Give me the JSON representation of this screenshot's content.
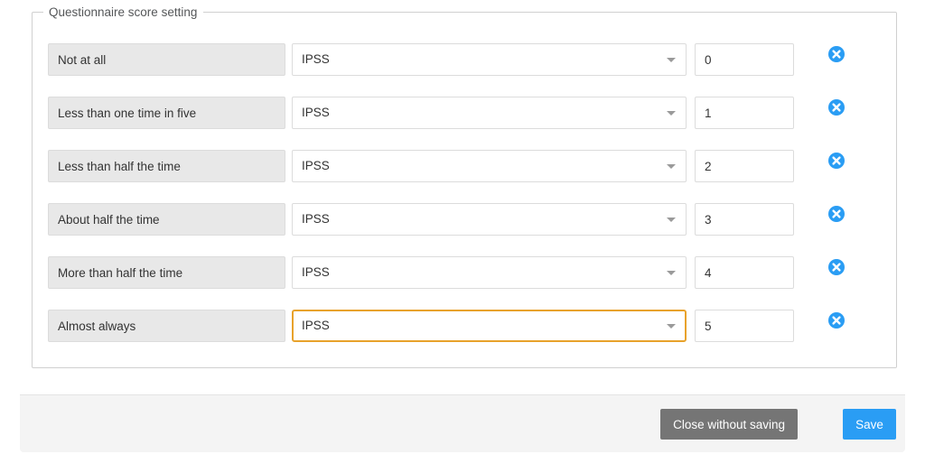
{
  "fieldset": {
    "legend": "Questionnaire score setting"
  },
  "colors": {
    "label_field_bg": "#e8e8e8",
    "focus_border": "#e8a22b",
    "delete_icon": "#2a9df4",
    "save_button": "#2a9df4",
    "close_button": "#757575",
    "footer_bg": "#f4f4f4",
    "border": "#dcdcdc"
  },
  "rows": [
    {
      "label": "Not at all",
      "questionnaire": "IPSS",
      "score": "0",
      "delete_icon": "remove-circle-icon",
      "focused": false
    },
    {
      "label": "Less than one time in five",
      "questionnaire": "IPSS",
      "score": "1",
      "delete_icon": "remove-circle-icon",
      "focused": false
    },
    {
      "label": "Less than half the time",
      "questionnaire": "IPSS",
      "score": "2",
      "delete_icon": "remove-circle-icon",
      "focused": false
    },
    {
      "label": "About half the time",
      "questionnaire": "IPSS",
      "score": "3",
      "delete_icon": "remove-circle-icon",
      "focused": false
    },
    {
      "label": "More than half the time",
      "questionnaire": "IPSS",
      "score": "4",
      "delete_icon": "remove-circle-icon",
      "focused": false
    },
    {
      "label": "Almost always",
      "questionnaire": "IPSS",
      "score": "5",
      "delete_icon": "remove-circle-icon",
      "focused": true
    }
  ],
  "select_options": [
    "IPSS"
  ],
  "footer": {
    "close_label": "Close without saving",
    "save_label": "Save"
  }
}
